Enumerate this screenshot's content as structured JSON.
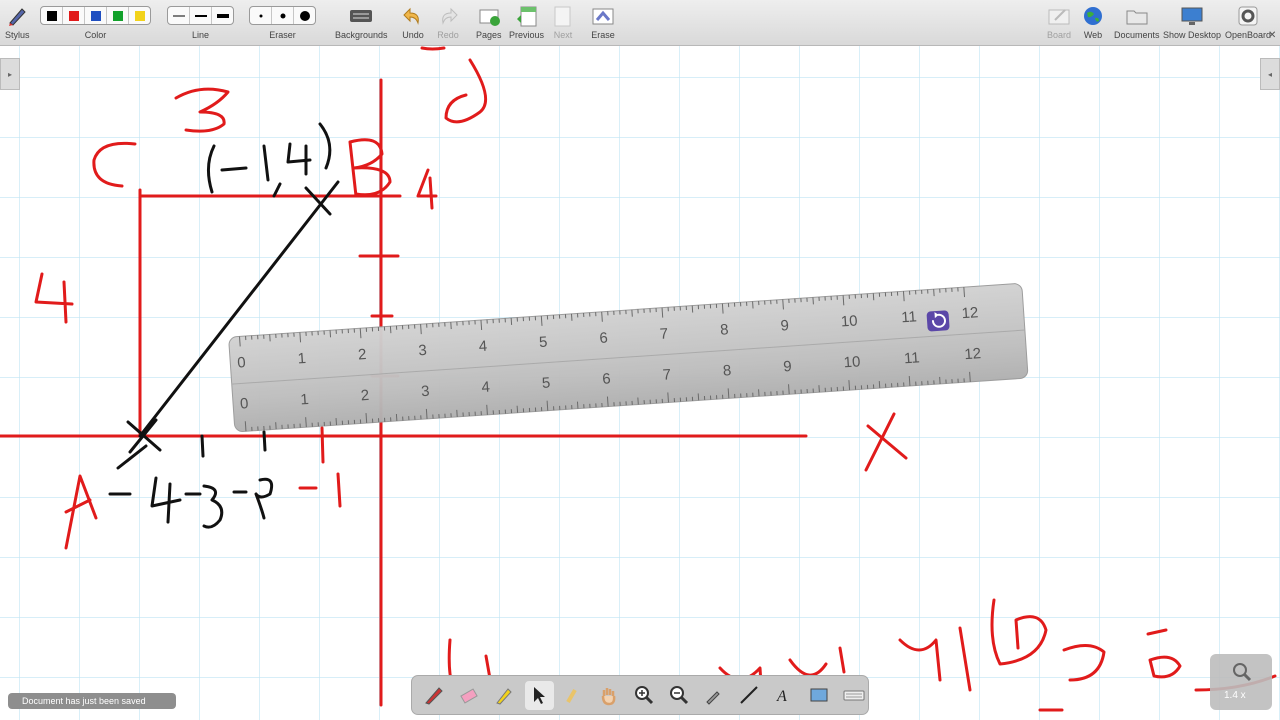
{
  "toolbar": {
    "stylus": {
      "label": "Stylus",
      "icon": "stylus-icon"
    },
    "color": {
      "label": "Color",
      "swatches": [
        "#000000",
        "#e11b1b",
        "#1f4fc1",
        "#12a12b",
        "#f2d21a"
      ]
    },
    "line": {
      "label": "Line"
    },
    "eraser": {
      "label": "Eraser"
    },
    "backgrounds": {
      "label": "Backgrounds",
      "icon": "keyboard-icon"
    },
    "undo": {
      "label": "Undo",
      "icon": "undo-icon"
    },
    "redo": {
      "label": "Redo",
      "icon": "redo-icon"
    },
    "pages": {
      "label": "Pages",
      "icon": "add-page-icon"
    },
    "previous": {
      "label": "Previous",
      "icon": "previous-page-icon"
    },
    "next": {
      "label": "Next",
      "icon": "next-page-icon"
    },
    "erase": {
      "label": "Erase",
      "icon": "erase-page-icon"
    },
    "board": {
      "label": "Board",
      "icon": "board-icon"
    },
    "web": {
      "label": "Web",
      "icon": "globe-icon"
    },
    "documents": {
      "label": "Documents",
      "icon": "folder-icon"
    },
    "show_desktop": {
      "label": "Show Desktop",
      "icon": "monitor-icon"
    },
    "openboard": {
      "label": "OpenBoard",
      "icon": "gear-icon"
    }
  },
  "ruler": {
    "top_numbers": [
      "0",
      "1",
      "2",
      "3",
      "4",
      "5",
      "6",
      "7",
      "8",
      "9",
      "10",
      "11",
      "12"
    ],
    "bottom_numbers": [
      "0",
      "1",
      "2",
      "3",
      "4",
      "5",
      "6",
      "7",
      "8",
      "9",
      "10",
      "11",
      "12"
    ],
    "rotate_icon": "rotate-icon"
  },
  "handwriting": {
    "label_c": "C",
    "label_3": "3",
    "point_b": "(-1,4)",
    "label_b": "B",
    "label_4_right": "4",
    "label_4_left": "4",
    "label_x": "X",
    "label_a": "A",
    "axis_numbers": "-4 -3 -2 -1"
  },
  "status": {
    "message": "Document has just been saved"
  },
  "dock": {
    "tools": [
      "pen-icon",
      "eraser-icon",
      "highlighter-icon",
      "pointer-icon",
      "laser-pointer-icon",
      "hand-icon",
      "zoom-in-icon",
      "zoom-out-icon",
      "eyedropper-icon",
      "line-icon",
      "text-icon",
      "capture-icon",
      "keyboard-icon"
    ]
  },
  "zoom": {
    "level": "1.4 x"
  },
  "colors": {
    "grid": "#bfe4f3",
    "ink_red": "#e11b1b",
    "ink_black": "#000000",
    "ruler": "#c4c4c4"
  }
}
